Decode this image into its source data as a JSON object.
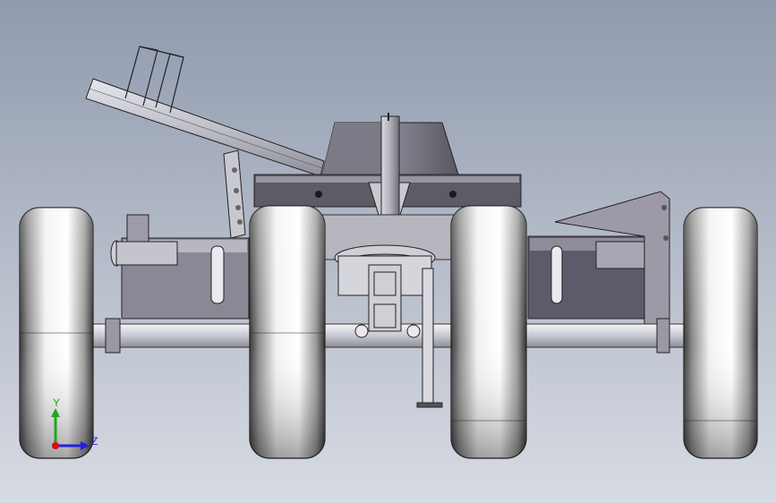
{
  "viewport": {
    "background_top": "#8f9aae",
    "background_bottom": "#d7dbe3"
  },
  "model": {
    "parts": [
      "handle-frame",
      "handle-clamp",
      "handle-link-plate",
      "gear-housing",
      "frame-plate",
      "main-shaft",
      "motor-block-left",
      "motor-block-right",
      "bracket-right",
      "axle",
      "center-hitch",
      "stand-leg",
      "wheel-left-outer",
      "wheel-left-inner",
      "wheel-right-inner",
      "wheel-right-outer"
    ]
  },
  "triad": {
    "y_label": "Y",
    "z_label": "Z",
    "y_color": "#1fa51f",
    "z_color": "#2020e0",
    "x_color": "#d01010"
  }
}
